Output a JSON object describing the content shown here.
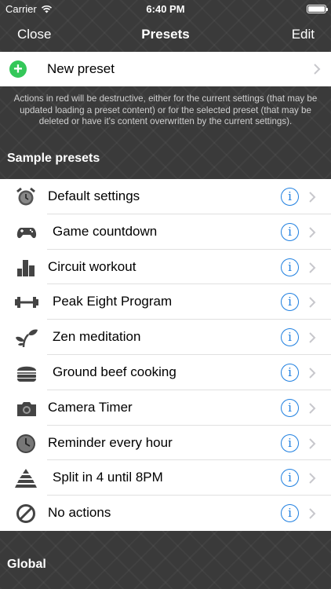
{
  "status_bar": {
    "carrier": "Carrier",
    "time": "6:40 PM"
  },
  "nav": {
    "left": "Close",
    "title": "Presets",
    "right": "Edit"
  },
  "new_preset": {
    "label": "New preset"
  },
  "note": "Actions in red will be destructive, either for the current settings (that may be updated loading a preset content) or for the selected preset (that may be deleted or have it's content overwritten by the current settings).",
  "sections": {
    "sample": "Sample presets",
    "global": "Global"
  },
  "presets": [
    {
      "label": "Default settings",
      "icon": "alarm-clock-icon"
    },
    {
      "label": "Game countdown",
      "icon": "gamepad-icon"
    },
    {
      "label": "Circuit workout",
      "icon": "bar-blocks-icon"
    },
    {
      "label": "Peak Eight Program",
      "icon": "dumbbell-icon"
    },
    {
      "label": "Zen meditation",
      "icon": "sprout-icon"
    },
    {
      "label": "Ground beef cooking",
      "icon": "burger-icon"
    },
    {
      "label": "Camera Timer",
      "icon": "camera-icon"
    },
    {
      "label": "Reminder every hour",
      "icon": "clock-icon"
    },
    {
      "label": "Split in 4 until 8PM",
      "icon": "pyramid-icon"
    },
    {
      "label": "No actions",
      "icon": "prohibited-icon"
    }
  ],
  "colors": {
    "accent": "#1e7fe0",
    "add": "#34c759",
    "background": "#3a3a3a"
  }
}
